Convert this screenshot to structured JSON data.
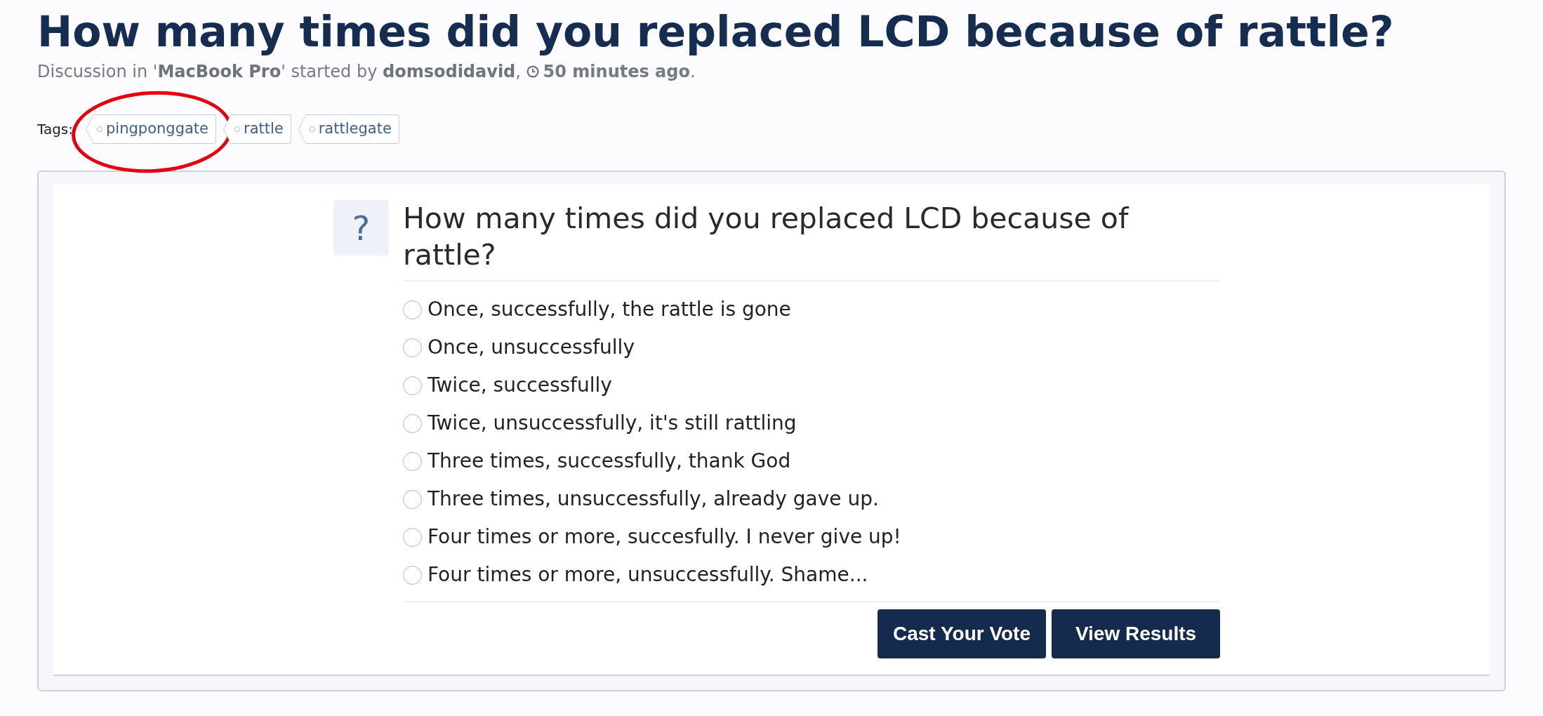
{
  "thread": {
    "title": "How many times did you replaced LCD because of rattle?",
    "meta": [
      {
        "kind": "text",
        "text": "Discussion in '"
      },
      {
        "kind": "forum",
        "text": "MacBook Pro"
      },
      {
        "kind": "text",
        "text": "' started by "
      },
      {
        "kind": "author",
        "text": "domsodidavid"
      },
      {
        "kind": "text",
        "text": ", "
      },
      {
        "kind": "time",
        "text": "50 minutes ago"
      },
      {
        "kind": "text",
        "text": "."
      }
    ]
  },
  "tags": {
    "label": "Tags:",
    "items": [
      {
        "text": "pingponggate",
        "circled": true
      },
      {
        "text": "rattle",
        "circled": false
      },
      {
        "text": "rattlegate",
        "circled": false
      }
    ]
  },
  "poll": {
    "icon": "?",
    "question": "How many times did you replaced LCD because of rattle?",
    "options": [
      {
        "label": "Once, successfully, the rattle is gone",
        "selected": false
      },
      {
        "label": "Once, unsuccessfully",
        "selected": false
      },
      {
        "label": "Twice, successfully",
        "selected": false
      },
      {
        "label": "Twice, unsuccessfully, it's still rattling",
        "selected": false
      },
      {
        "label": "Three times, successfully, thank God",
        "selected": false
      },
      {
        "label": "Three times, unsuccessfully, already gave up.",
        "selected": false
      },
      {
        "label": "Four times or more, succesfully. I never give up!",
        "selected": false
      },
      {
        "label": "Four times or more, unsuccessfully. Shame...",
        "selected": false
      }
    ],
    "buttons": [
      "Cast Your Vote",
      "View Results"
    ]
  }
}
